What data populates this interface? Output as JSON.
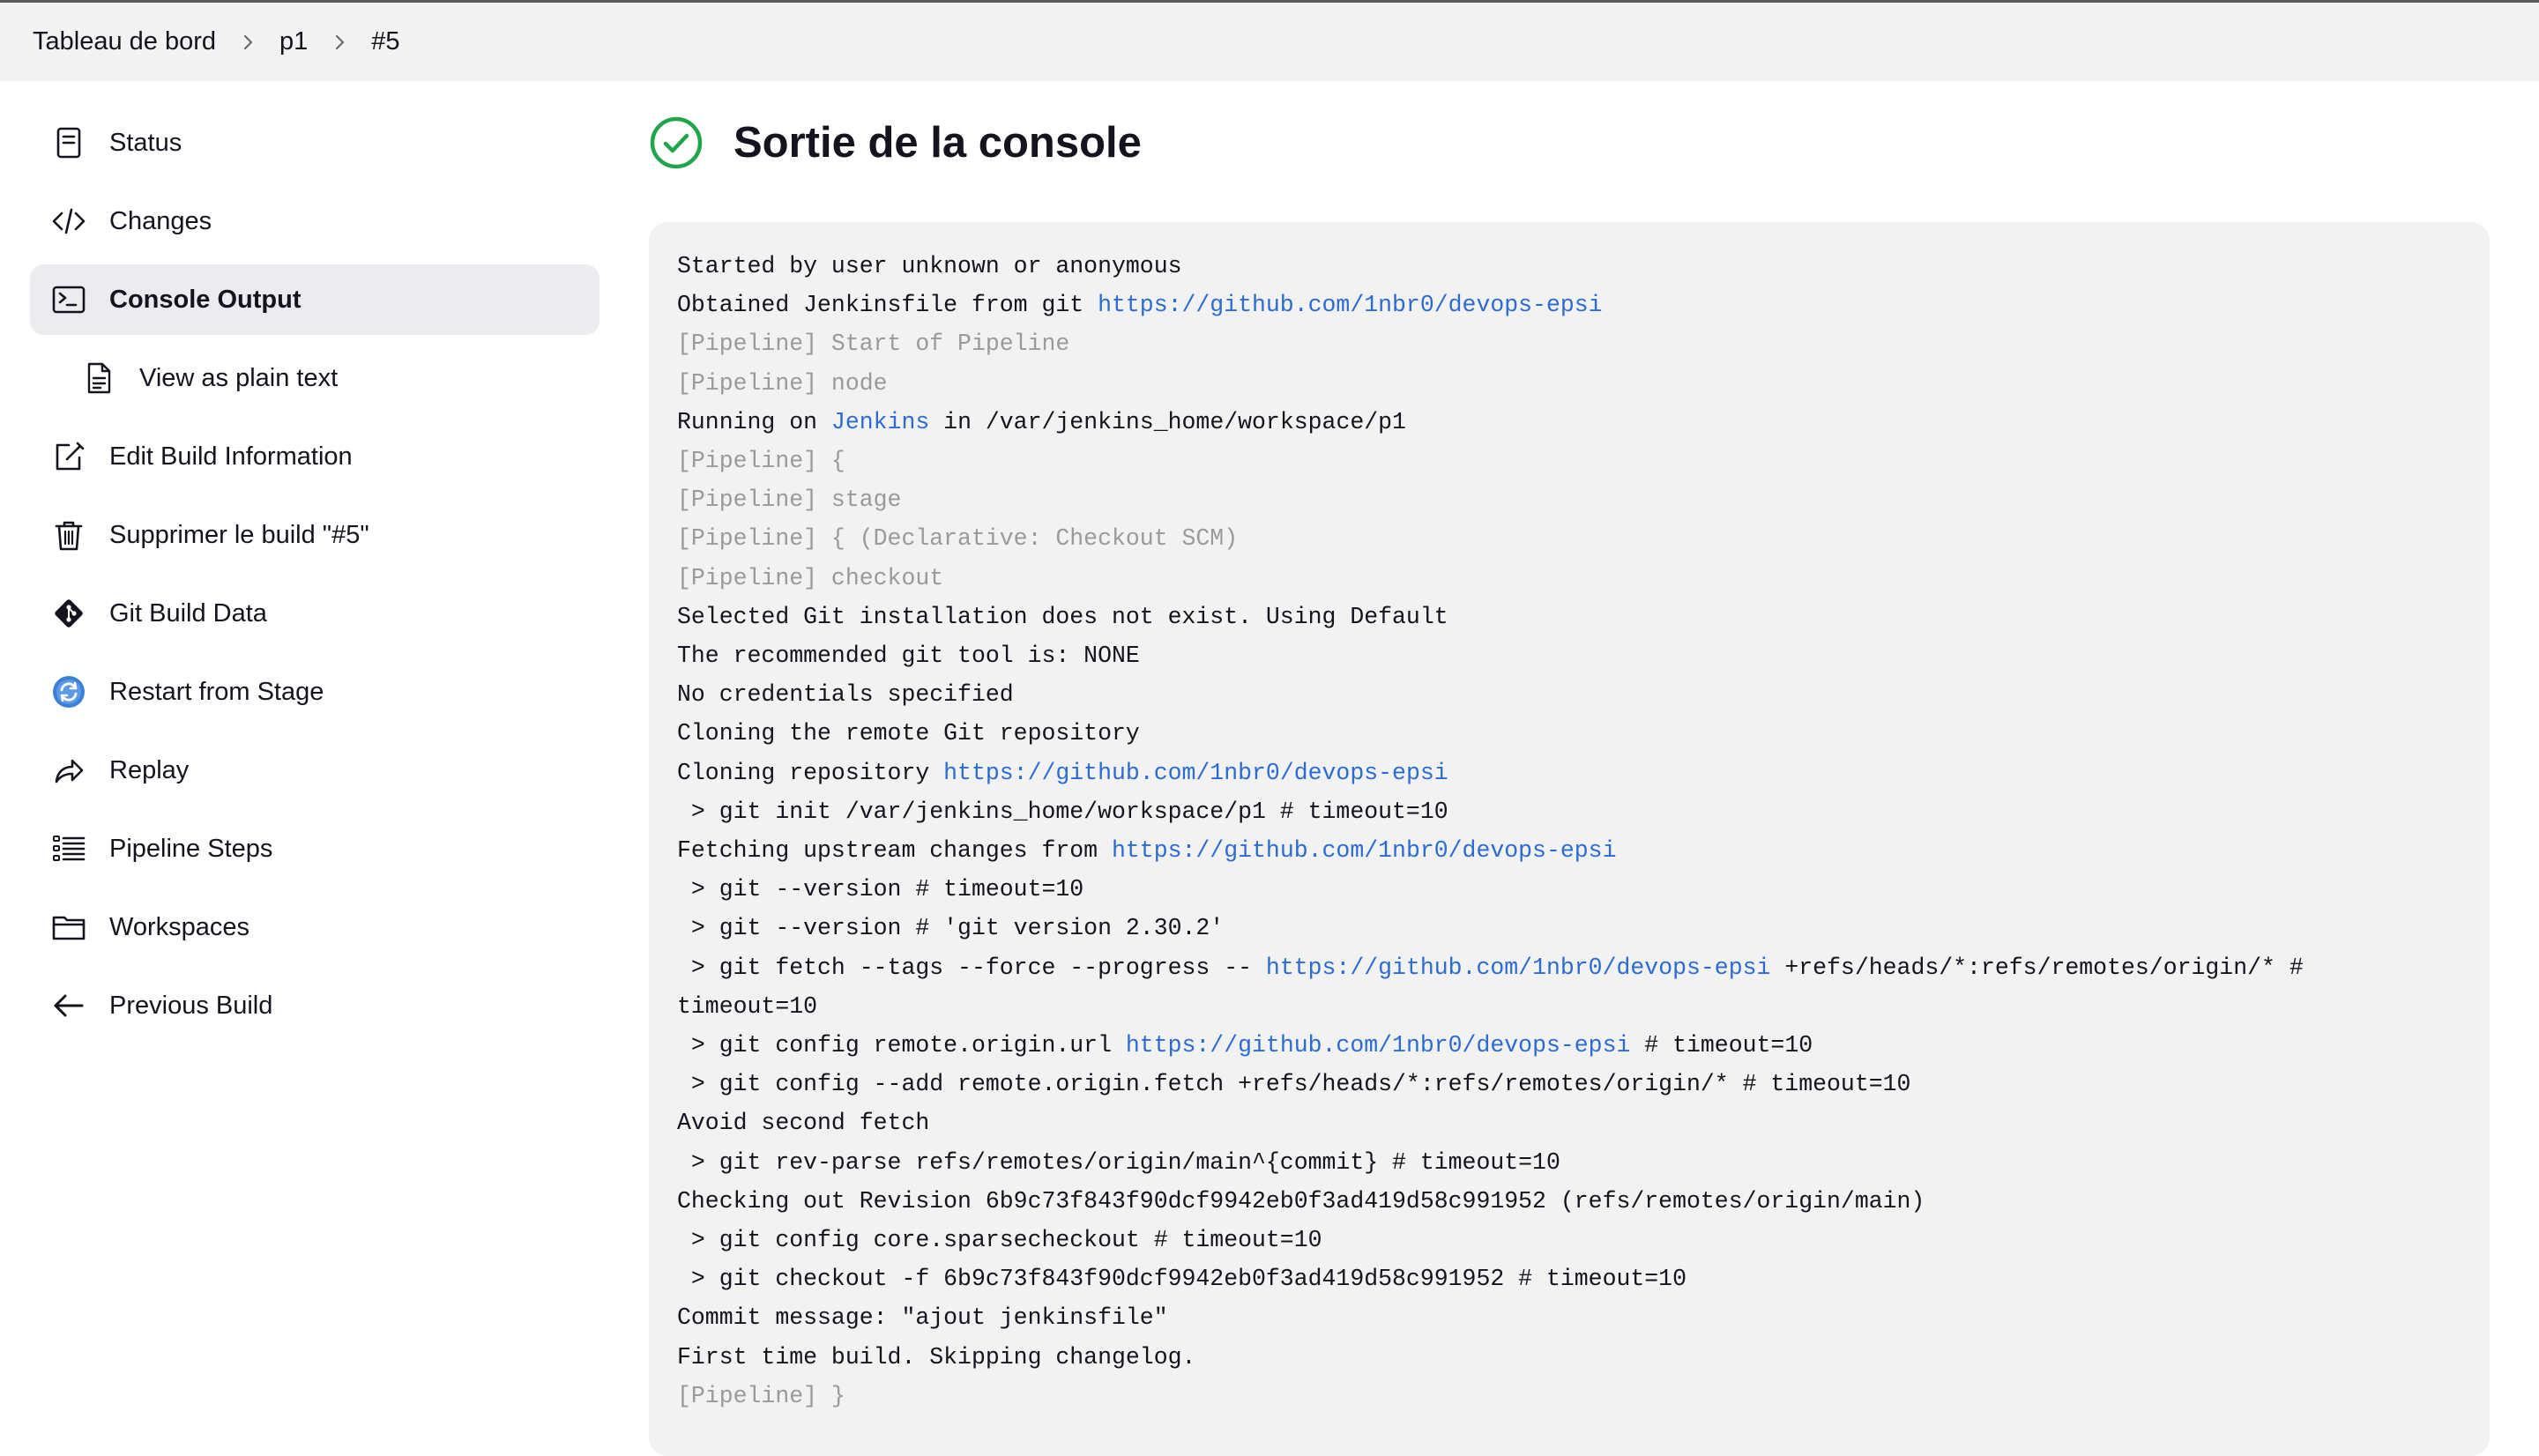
{
  "breadcrumb": [
    "Tableau de bord",
    "p1",
    "#5"
  ],
  "sidebar": {
    "items": [
      {
        "label": "Status",
        "icon": "document-icon"
      },
      {
        "label": "Changes",
        "icon": "code-icon"
      },
      {
        "label": "Console Output",
        "icon": "terminal-icon",
        "active": true
      },
      {
        "label": "View as plain text",
        "icon": "file-text-icon",
        "sub": true
      },
      {
        "label": "Edit Build Information",
        "icon": "edit-icon"
      },
      {
        "label": "Supprimer le build \"#5\"",
        "icon": "trash-icon"
      },
      {
        "label": "Git Build Data",
        "icon": "git-icon"
      },
      {
        "label": "Restart from Stage",
        "icon": "restart-icon"
      },
      {
        "label": "Replay",
        "icon": "replay-icon"
      },
      {
        "label": "Pipeline Steps",
        "icon": "list-icon"
      },
      {
        "label": "Workspaces",
        "icon": "folder-icon"
      },
      {
        "label": "Previous Build",
        "icon": "arrow-left-icon"
      }
    ]
  },
  "main": {
    "title": "Sortie de la console",
    "status_icon": "success-check-icon",
    "status_color": "#1ea64b",
    "link_color": "#2b6cd4"
  },
  "console": {
    "lines": [
      {
        "text": "Started by user unknown or anonymous"
      },
      {
        "text": "Obtained Jenkinsfile from git ",
        "link": "https://github.com/1nbr0/devops-epsi"
      },
      {
        "text": "[Pipeline] Start of Pipeline",
        "dim": true
      },
      {
        "text": "[Pipeline] node",
        "dim": true
      },
      {
        "text": "Running on ",
        "link": "Jenkins",
        "after": " in /var/jenkins_home/workspace/p1"
      },
      {
        "text": "[Pipeline] {",
        "dim": true
      },
      {
        "text": "[Pipeline] stage",
        "dim": true
      },
      {
        "text": "[Pipeline] { (Declarative: Checkout SCM)",
        "dim": true
      },
      {
        "text": "[Pipeline] checkout",
        "dim": true
      },
      {
        "text": "Selected Git installation does not exist. Using Default"
      },
      {
        "text": "The recommended git tool is: NONE"
      },
      {
        "text": "No credentials specified"
      },
      {
        "text": "Cloning the remote Git repository"
      },
      {
        "text": "Cloning repository ",
        "link": "https://github.com/1nbr0/devops-epsi"
      },
      {
        "text": " > git init /var/jenkins_home/workspace/p1 # timeout=10"
      },
      {
        "text": "Fetching upstream changes from ",
        "link": "https://github.com/1nbr0/devops-epsi"
      },
      {
        "text": " > git --version # timeout=10"
      },
      {
        "text": " > git --version # 'git version 2.30.2'"
      },
      {
        "text": " > git fetch --tags --force --progress -- ",
        "link": "https://github.com/1nbr0/devops-epsi",
        "after": " +refs/heads/*:refs/remotes/origin/* #"
      },
      {
        "text": "timeout=10"
      },
      {
        "text": " > git config remote.origin.url ",
        "link": "https://github.com/1nbr0/devops-epsi",
        "after": " # timeout=10"
      },
      {
        "text": " > git config --add remote.origin.fetch +refs/heads/*:refs/remotes/origin/* # timeout=10"
      },
      {
        "text": "Avoid second fetch"
      },
      {
        "text": " > git rev-parse refs/remotes/origin/main^{commit} # timeout=10"
      },
      {
        "text": "Checking out Revision 6b9c73f843f90dcf9942eb0f3ad419d58c991952 (refs/remotes/origin/main)"
      },
      {
        "text": " > git config core.sparsecheckout # timeout=10"
      },
      {
        "text": " > git checkout -f 6b9c73f843f90dcf9942eb0f3ad419d58c991952 # timeout=10"
      },
      {
        "text": "Commit message: \"ajout jenkinsfile\""
      },
      {
        "text": "First time build. Skipping changelog."
      },
      {
        "text": "[Pipeline] }",
        "dim": true
      }
    ]
  }
}
